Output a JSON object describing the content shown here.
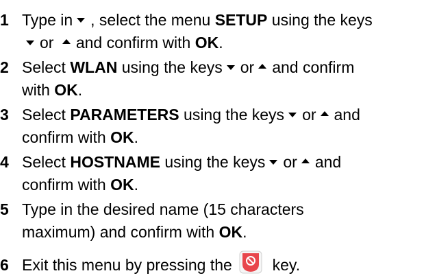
{
  "steps": [
    {
      "num": "1",
      "parts": {
        "a": "Type in",
        "b": ", select the menu",
        "c": "SETUP",
        "d": "using the keys",
        "e": "or",
        "f": "and confirm with",
        "g": "OK",
        "h": "."
      }
    },
    {
      "num": "2",
      "parts": {
        "a": "Select",
        "b": "WLAN",
        "c": "using the keys",
        "d": "or",
        "e": "and confirm",
        "f": "with",
        "g": "OK",
        "h": "."
      }
    },
    {
      "num": "3",
      "parts": {
        "a": "Select",
        "b": "PARAMETERS",
        "c": "using the keys",
        "d": "or",
        "e": "and",
        "f": "confirm with",
        "g": "OK",
        "h": "."
      }
    },
    {
      "num": "4",
      "parts": {
        "a": "Select",
        "b": "HOSTNAME",
        "c": "using the keys",
        "d": "or",
        "e": "and",
        "f": "confirm with",
        "g": "OK",
        "h": "."
      }
    },
    {
      "num": "5",
      "parts": {
        "a": "Type in the desired name (15 characters",
        "b": "maximum) and confirm with",
        "c": "OK",
        "d": "."
      }
    },
    {
      "num": "6",
      "parts": {
        "a": "Exit this menu by pressing the",
        "b": "key."
      }
    }
  ],
  "icons": {
    "down": "arrow-down-icon",
    "up": "arrow-up-icon",
    "exit_key": "exit-key-icon"
  },
  "colors": {
    "exit_key_red": "#e8464c",
    "exit_key_bg": "#f6f6f6"
  }
}
